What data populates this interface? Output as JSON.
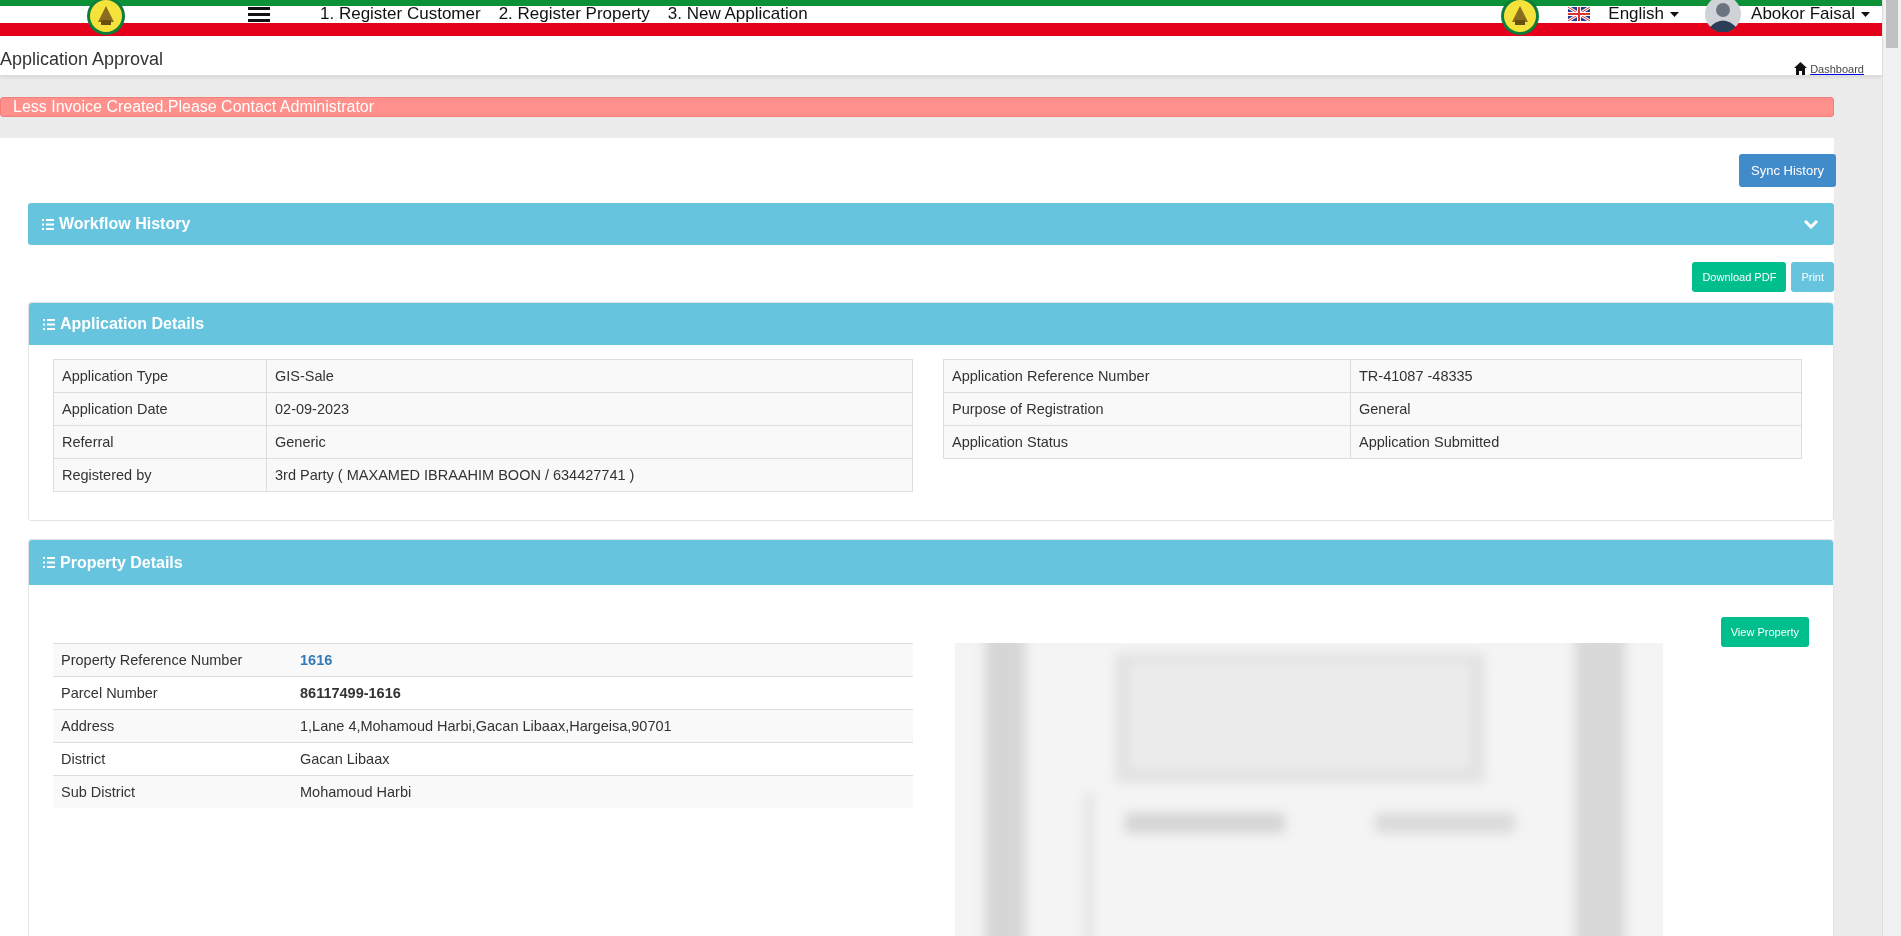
{
  "top_bar": {
    "nav_links": [
      "1. Register Customer",
      "2. Register Property",
      "3. New Application"
    ],
    "language": "English",
    "user": "Abokor Faisal"
  },
  "page_header": {
    "title": "Application Approval",
    "breadcrumb": "Dashboard"
  },
  "alert": {
    "message": "Less Invoice Created.Please Contact Administrator"
  },
  "sync_button": "Sync History",
  "workflow_panel": {
    "title": "Workflow History",
    "expanded": false
  },
  "export_buttons": [
    {
      "label": "Download PDF",
      "kind": "success"
    },
    {
      "label": "Print",
      "kind": "info"
    }
  ],
  "application_details": {
    "title": "Application Details",
    "left_rows": [
      {
        "label": "Application Type",
        "value": "GIS-Sale"
      },
      {
        "label": "Application Date",
        "value": "02-09-2023"
      },
      {
        "label": "Referral",
        "value": "Generic"
      },
      {
        "label": "Registered by",
        "value": "3rd Party ( MAXAMED IBRAAHIM BOON / 634427741 )"
      }
    ],
    "right_rows": [
      {
        "label": "Application Reference Number",
        "value": "TR-41087 -48335"
      },
      {
        "label": "Purpose of Registration",
        "value": "General"
      },
      {
        "label": "Application Status",
        "value": "Application Submitted"
      }
    ]
  },
  "property_details": {
    "title": "Property Details",
    "button": "View Property",
    "rows": [
      {
        "label": "Property Reference Number",
        "value": "1616",
        "kind": "link"
      },
      {
        "label": "Parcel Number",
        "value": "86117499-1616",
        "kind": "bold"
      },
      {
        "label": "Address",
        "value": "1,Lane 4,Mohamoud Harbi,Gacan Libaax,Hargeisa,90701",
        "kind": "plain"
      },
      {
        "label": "District",
        "value": "Gacan Libaax",
        "kind": "plain"
      },
      {
        "label": "Sub District",
        "value": "Mohamoud Harbi",
        "kind": "plain"
      }
    ]
  }
}
